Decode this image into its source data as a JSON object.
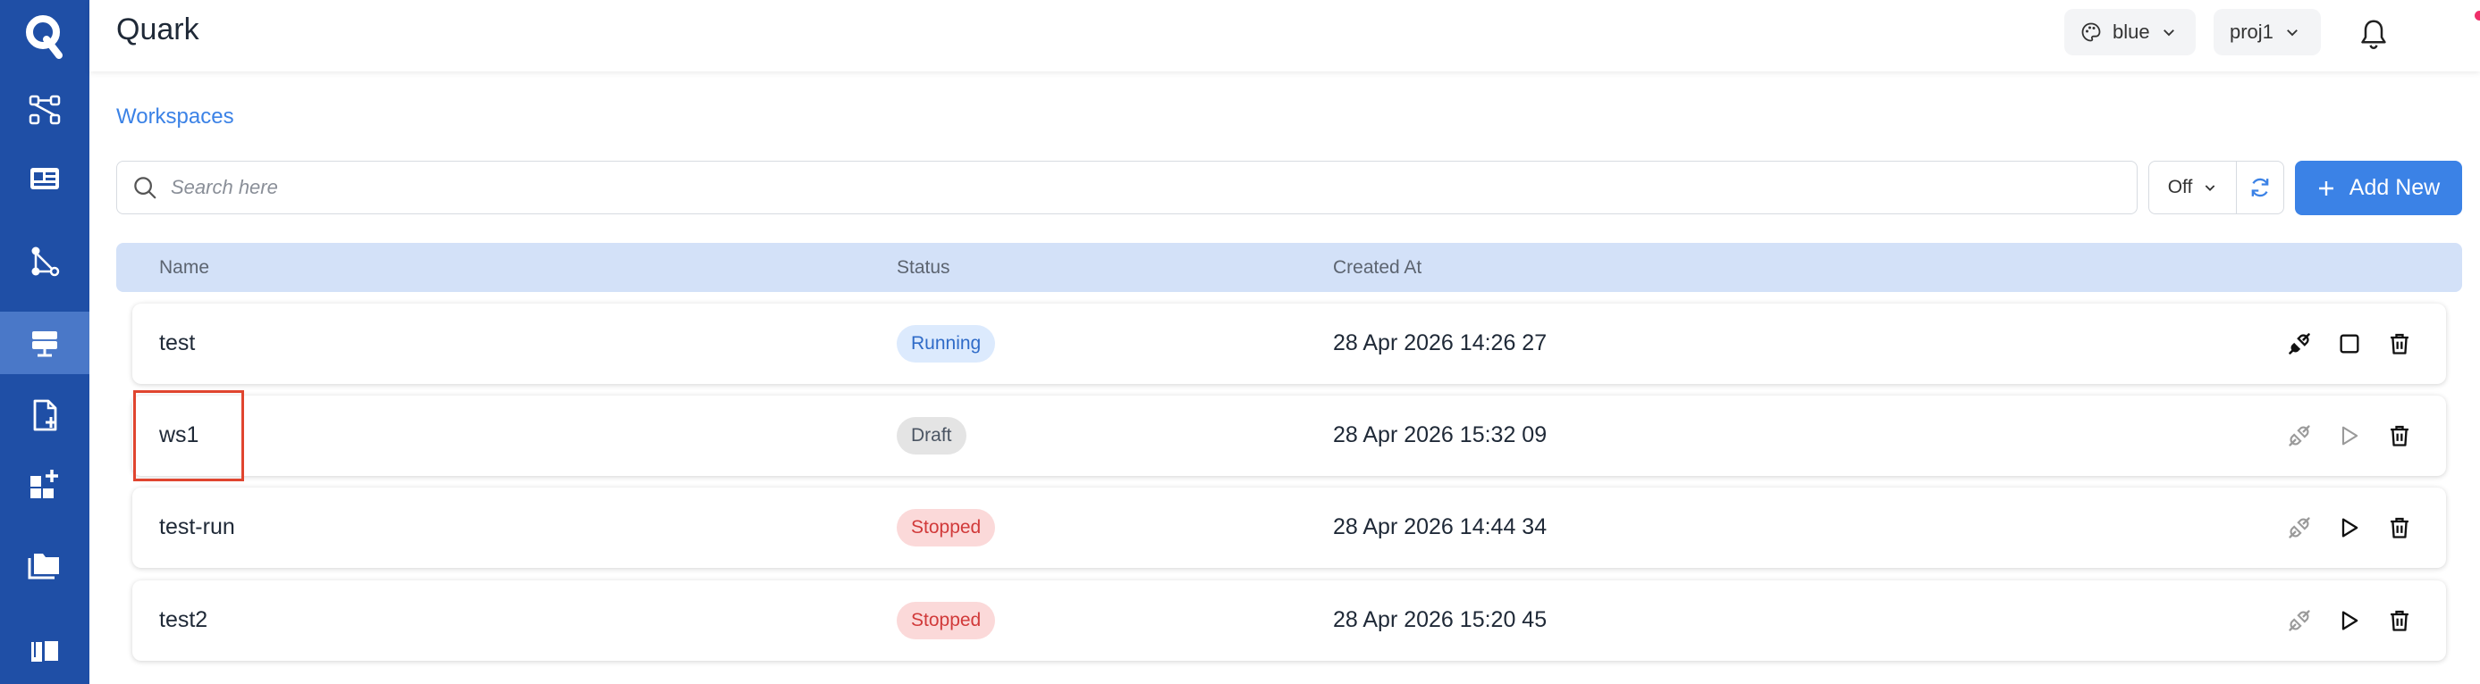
{
  "app": {
    "title": "Quark",
    "logo_letter": "Q"
  },
  "sidebar": {
    "items": [
      {
        "name": "pipelines",
        "icon": "flow-icon",
        "active": false
      },
      {
        "name": "dashboards",
        "icon": "dashboard-icon",
        "active": false
      },
      {
        "name": "graphs",
        "icon": "graph-icon",
        "active": false
      },
      {
        "name": "workspaces",
        "icon": "server-icon",
        "active": true
      },
      {
        "name": "new-file",
        "icon": "file-plus-icon",
        "active": false
      },
      {
        "name": "add-widget",
        "icon": "widget-plus-icon",
        "active": false
      },
      {
        "name": "folders",
        "icon": "folder-icon",
        "active": false
      },
      {
        "name": "docs",
        "icon": "book-icon",
        "active": false
      }
    ]
  },
  "header": {
    "theme_label": "blue",
    "project_label": "proj1",
    "theme_icon": "palette-icon",
    "notification_icon": "bell-icon",
    "user_icon": "user-icon"
  },
  "breadcrumb": {
    "label": "Workspaces"
  },
  "search": {
    "placeholder": "Search here",
    "value": ""
  },
  "refresh": {
    "interval_label": "Off"
  },
  "add_button": {
    "label": "Add New"
  },
  "table": {
    "columns": [
      "Name",
      "Status",
      "Created At"
    ],
    "rows": [
      {
        "name": "test",
        "status": "Running",
        "status_kind": "running",
        "created_at": "28 Apr 2026 14:26 27",
        "connect_enabled": true,
        "primary_action": "stop"
      },
      {
        "name": "ws1",
        "status": "Draft",
        "status_kind": "draft",
        "created_at": "28 Apr 2026 15:32 09",
        "connect_enabled": false,
        "primary_action": "start-disabled"
      },
      {
        "name": "test-run",
        "status": "Stopped",
        "status_kind": "stopped",
        "created_at": "28 Apr 2026 14:44 34",
        "connect_enabled": false,
        "primary_action": "start"
      },
      {
        "name": "test2",
        "status": "Stopped",
        "status_kind": "stopped",
        "created_at": "28 Apr 2026 15:20 45",
        "connect_enabled": false,
        "primary_action": "start"
      }
    ]
  },
  "colors": {
    "sidebar": "#1f4fa6",
    "accent": "#3b82e6",
    "table_header": "#d3e1f8",
    "highlight_box": "#e0452f"
  }
}
